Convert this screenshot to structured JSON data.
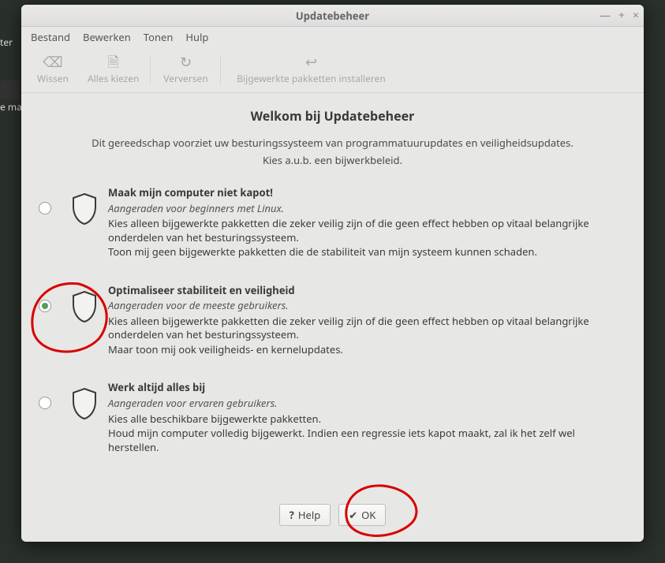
{
  "titlebar": {
    "title": "Updatebeheer"
  },
  "menubar": {
    "items": [
      "Bestand",
      "Bewerken",
      "Tonen",
      "Hulp"
    ]
  },
  "toolbar": {
    "clear": "Wissen",
    "select_all": "Alles kiezen",
    "refresh": "Verversen",
    "install": "Bijgewerkte pakketten installeren"
  },
  "welcome": {
    "title": "Welkom bij Updatebeheer",
    "line1": "Dit gereedschap voorziet uw besturingssysteem van programmatuurupdates en veiligheidsupdates.",
    "line2": "Kies a.u.b. een bijwerkbeleid."
  },
  "options": [
    {
      "title": "Maak mijn computer niet kapot!",
      "recommended": "Aangeraden voor beginners met Linux.",
      "line1": "Kies alleen bijgewerkte pakketten die zeker veilig zijn of die geen effect hebben op vitaal belangrijke onderdelen van het besturingssysteem.",
      "line2": "Toon mij geen bijgewerkte pakketten die de stabiliteit van mijn systeem kunnen schaden.",
      "selected": false
    },
    {
      "title": "Optimaliseer stabiliteit en veiligheid",
      "recommended": "Aangeraden voor de meeste gebruikers.",
      "line1": "Kies alleen bijgewerkte pakketten die zeker veilig zijn of die geen effect hebben op vitaal belangrijke onderdelen van het besturingssysteem.",
      "line2": "Maar toon mij ook veiligheids- en kernelupdates.",
      "selected": true
    },
    {
      "title": "Werk altijd alles bij",
      "recommended": "Aangeraden voor ervaren gebruikers.",
      "line1": "Kies alle beschikbare bijgewerkte pakketten.",
      "line2": "Houd mijn computer volledig bijgewerkt. Indien een regressie iets kapot maakt, zal ik het zelf wel herstellen.",
      "selected": false
    }
  ],
  "buttons": {
    "help": "Help",
    "ok": "OK"
  },
  "desktop_fragments": {
    "label1": "ter",
    "label2": "e ma"
  },
  "annotation_color": "#d80000"
}
